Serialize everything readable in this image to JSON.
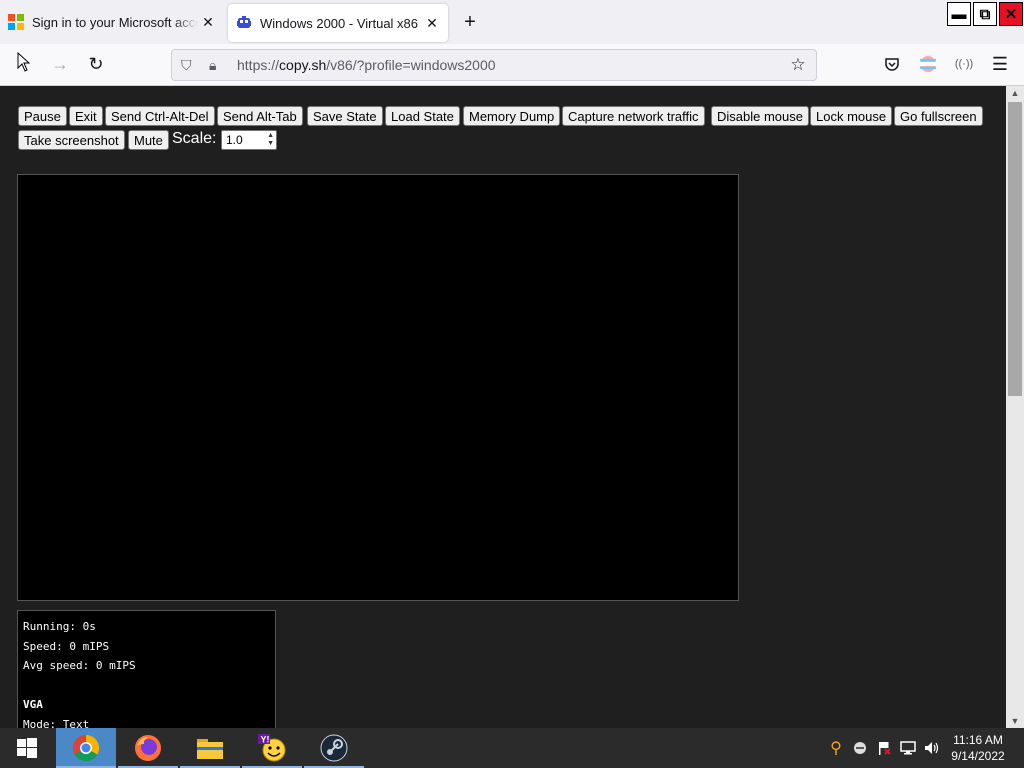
{
  "browser": {
    "tabs": [
      {
        "title": "Sign in to your Microsoft account",
        "active": false
      },
      {
        "title": "Windows 2000 - Virtual x86",
        "active": true
      }
    ],
    "url_host": "copy.sh",
    "url_prefix": "https://",
    "url_path": "/v86/?profile=windows2000",
    "window_controls": {
      "minimize": "▬",
      "maximize": "⧉",
      "close": "✕"
    }
  },
  "controls": {
    "buttons": [
      {
        "label": "Pause",
        "name": "pause-button"
      },
      {
        "label": "Exit",
        "name": "exit-button"
      },
      {
        "label": "Send Ctrl-Alt-Del",
        "name": "send-ctrl-alt-del-button"
      },
      {
        "label": "Send Alt-Tab",
        "name": "send-alt-tab-button"
      },
      {
        "label": "Save State",
        "name": "save-state-button"
      },
      {
        "label": "Load State",
        "name": "load-state-button"
      },
      {
        "label": "Memory Dump",
        "name": "memory-dump-button"
      },
      {
        "label": "Capture network traffic",
        "name": "capture-network-traffic-button"
      },
      {
        "label": "Disable mouse",
        "name": "disable-mouse-button"
      },
      {
        "label": "Lock mouse",
        "name": "lock-mouse-button"
      },
      {
        "label": "Go fullscreen",
        "name": "go-fullscreen-button"
      },
      {
        "label": "Take screenshot",
        "name": "take-screenshot-button"
      },
      {
        "label": "Mute",
        "name": "mute-button"
      }
    ],
    "scale_label": "Scale:",
    "scale_value": "1.0"
  },
  "info": {
    "running": "Running: 0s",
    "speed": "Speed: 0 mIPS",
    "avg_speed": "Avg speed: 0 mIPS",
    "vga_heading": "VGA",
    "mode": "Mode: Text"
  },
  "taskbar": {
    "apps": [
      "windows-start-icon",
      "chrome-icon",
      "firefox-icon",
      "file-explorer-icon",
      "yahoo-messenger-icon",
      "steam-icon"
    ],
    "clock_time": "11:16 AM",
    "clock_date": "9/14/2022"
  },
  "colors": {
    "page_bg": "#1f1f1f",
    "taskbar_bg": "#2b2b2b",
    "active_indicator": "#8fb5e0"
  }
}
